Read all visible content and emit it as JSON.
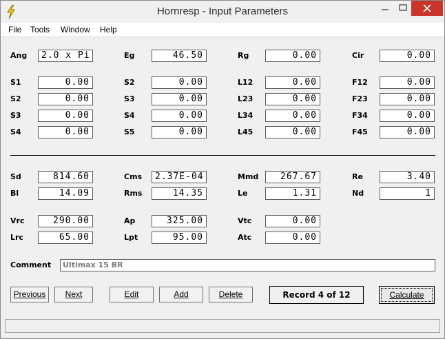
{
  "window": {
    "title": "Hornresp - Input Parameters"
  },
  "menu": [
    "File",
    "Tools",
    "Window",
    "Help"
  ],
  "fields": {
    "ang": {
      "label": "Ang",
      "value": "2.0 x Pi"
    },
    "eg": {
      "label": "Eg",
      "value": "46.50"
    },
    "rg": {
      "label": "Rg",
      "value": "0.00"
    },
    "cir": {
      "label": "Cir",
      "value": "0.00"
    },
    "s1": {
      "label": "S1",
      "value": "0.00"
    },
    "s2a": {
      "label": "S2",
      "value": "0.00"
    },
    "l12": {
      "label": "L12",
      "value": "0.00"
    },
    "f12": {
      "label": "F12",
      "value": "0.00"
    },
    "s2": {
      "label": "S2",
      "value": "0.00"
    },
    "s3a": {
      "label": "S3",
      "value": "0.00"
    },
    "l23": {
      "label": "L23",
      "value": "0.00"
    },
    "f23": {
      "label": "F23",
      "value": "0.00"
    },
    "s3": {
      "label": "S3",
      "value": "0.00"
    },
    "s4a": {
      "label": "S4",
      "value": "0.00"
    },
    "l34": {
      "label": "L34",
      "value": "0.00"
    },
    "f34": {
      "label": "F34",
      "value": "0.00"
    },
    "s4": {
      "label": "S4",
      "value": "0.00"
    },
    "s5": {
      "label": "S5",
      "value": "0.00"
    },
    "l45": {
      "label": "L45",
      "value": "0.00"
    },
    "f45": {
      "label": "F45",
      "value": "0.00"
    },
    "sd": {
      "label": "Sd",
      "value": "814.60"
    },
    "cms": {
      "label": "Cms",
      "value": "2.37E-04"
    },
    "mmd": {
      "label": "Mmd",
      "value": "267.67"
    },
    "re": {
      "label": "Re",
      "value": "3.40"
    },
    "bl": {
      "label": "Bl",
      "value": "14.09"
    },
    "rms": {
      "label": "Rms",
      "value": "14.35"
    },
    "le": {
      "label": "Le",
      "value": "1.31"
    },
    "nd": {
      "label": "Nd",
      "value": "1"
    },
    "vrc": {
      "label": "Vrc",
      "value": "290.00"
    },
    "ap": {
      "label": "Ap",
      "value": "325.00"
    },
    "vtc": {
      "label": "Vtc",
      "value": "0.00"
    },
    "lrc": {
      "label": "Lrc",
      "value": "65.00"
    },
    "lpt": {
      "label": "Lpt",
      "value": "95.00"
    },
    "atc": {
      "label": "Atc",
      "value": "0.00"
    }
  },
  "comment": {
    "label": "Comment",
    "value": "Ultimax 15 BR"
  },
  "buttons": {
    "previous": "Previous",
    "next": "Next",
    "edit": "Edit",
    "add": "Add",
    "delete": "Delete",
    "calculate": "Calculate"
  },
  "record": "Record 4 of 12",
  "icons": {
    "app": "lightning-bolt-icon",
    "minimize": "minimize-icon",
    "maximize": "maximize-icon",
    "close": "close-icon"
  },
  "colors": {
    "close_button": "#c7352b",
    "app_icon": "#f5d800"
  }
}
